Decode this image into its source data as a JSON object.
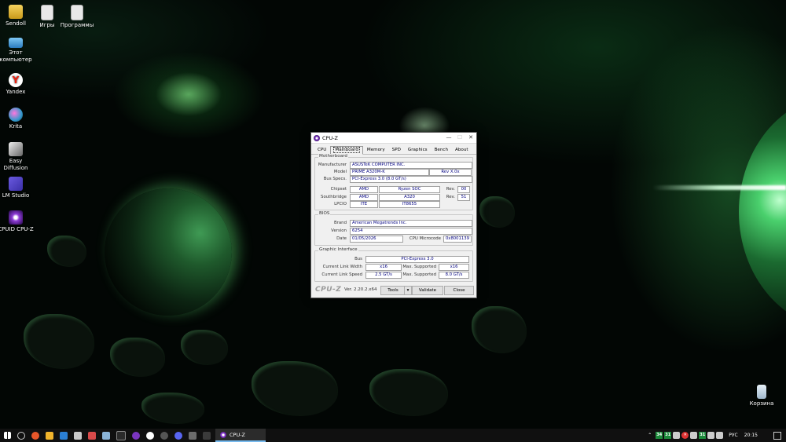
{
  "desktop": {
    "icons": [
      {
        "label": "Sendoll"
      },
      {
        "label": "Игры"
      },
      {
        "label": "Программы"
      },
      {
        "label": "Этот компьютер"
      },
      {
        "label": "Yandex"
      },
      {
        "label": "Krita"
      },
      {
        "label": "Easy Diffusion"
      },
      {
        "label": "LM Studio"
      },
      {
        "label": "CPUID CPU-Z"
      },
      {
        "label": "Корзина"
      }
    ]
  },
  "cpuz": {
    "title": "CPU-Z",
    "tabs": [
      "CPU",
      "Mainboard",
      "Memory",
      "SPD",
      "Graphics",
      "Bench",
      "About"
    ],
    "active_tab": "Mainboard",
    "motherboard": {
      "group_title": "Motherboard",
      "manufacturer_label": "Manufacturer",
      "manufacturer": "ASUSTeK COMPUTER INC.",
      "model_label": "Model",
      "model": "PRIME A320M-K",
      "model_rev": "Rev X.0x",
      "bus_specs_label": "Bus Specs.",
      "bus_specs": "PCI-Express 3.0 (8.0 GT/s)",
      "chipset_label": "Chipset",
      "chipset_vendor": "AMD",
      "chipset_name": "Ryzen SOC",
      "chipset_rev_label": "Rev.",
      "chipset_rev": "00",
      "southbridge_label": "Southbridge",
      "southbridge_vendor": "AMD",
      "southbridge_name": "A320",
      "southbridge_rev_label": "Rev.",
      "southbridge_rev": "51",
      "lpcio_label": "LPCIO",
      "lpcio_vendor": "ITE",
      "lpcio_name": "IT8655"
    },
    "bios": {
      "group_title": "BIOS",
      "brand_label": "Brand",
      "brand": "American Megatrends Inc.",
      "version_label": "Version",
      "version": "6254",
      "date_label": "Date",
      "date": "01/05/2026",
      "microcode_label": "CPU Microcode",
      "microcode": "0x8001139"
    },
    "graphic_interface": {
      "group_title": "Graphic Interface",
      "bus_label": "Bus",
      "bus": "PCI-Express 3.0",
      "link_width_label": "Current Link Width",
      "link_width": "x16",
      "max_width_label": "Max. Supported",
      "max_width": "x16",
      "link_speed_label": "Current Link Speed",
      "link_speed": "2.5 GT/s",
      "max_speed_label": "Max. Supported",
      "max_speed": "8.0 GT/s"
    },
    "footer": {
      "logo": "CPU-Z",
      "version": "Ver. 2.20.2.x64",
      "tools_label": "Tools",
      "validate_label": "Validate",
      "close_label": "Close"
    }
  },
  "taskbar": {
    "active_task_label": "CPU-Z",
    "tray_numbers": [
      "34",
      "31",
      "31"
    ],
    "language": "РУС",
    "time": "20:15"
  }
}
